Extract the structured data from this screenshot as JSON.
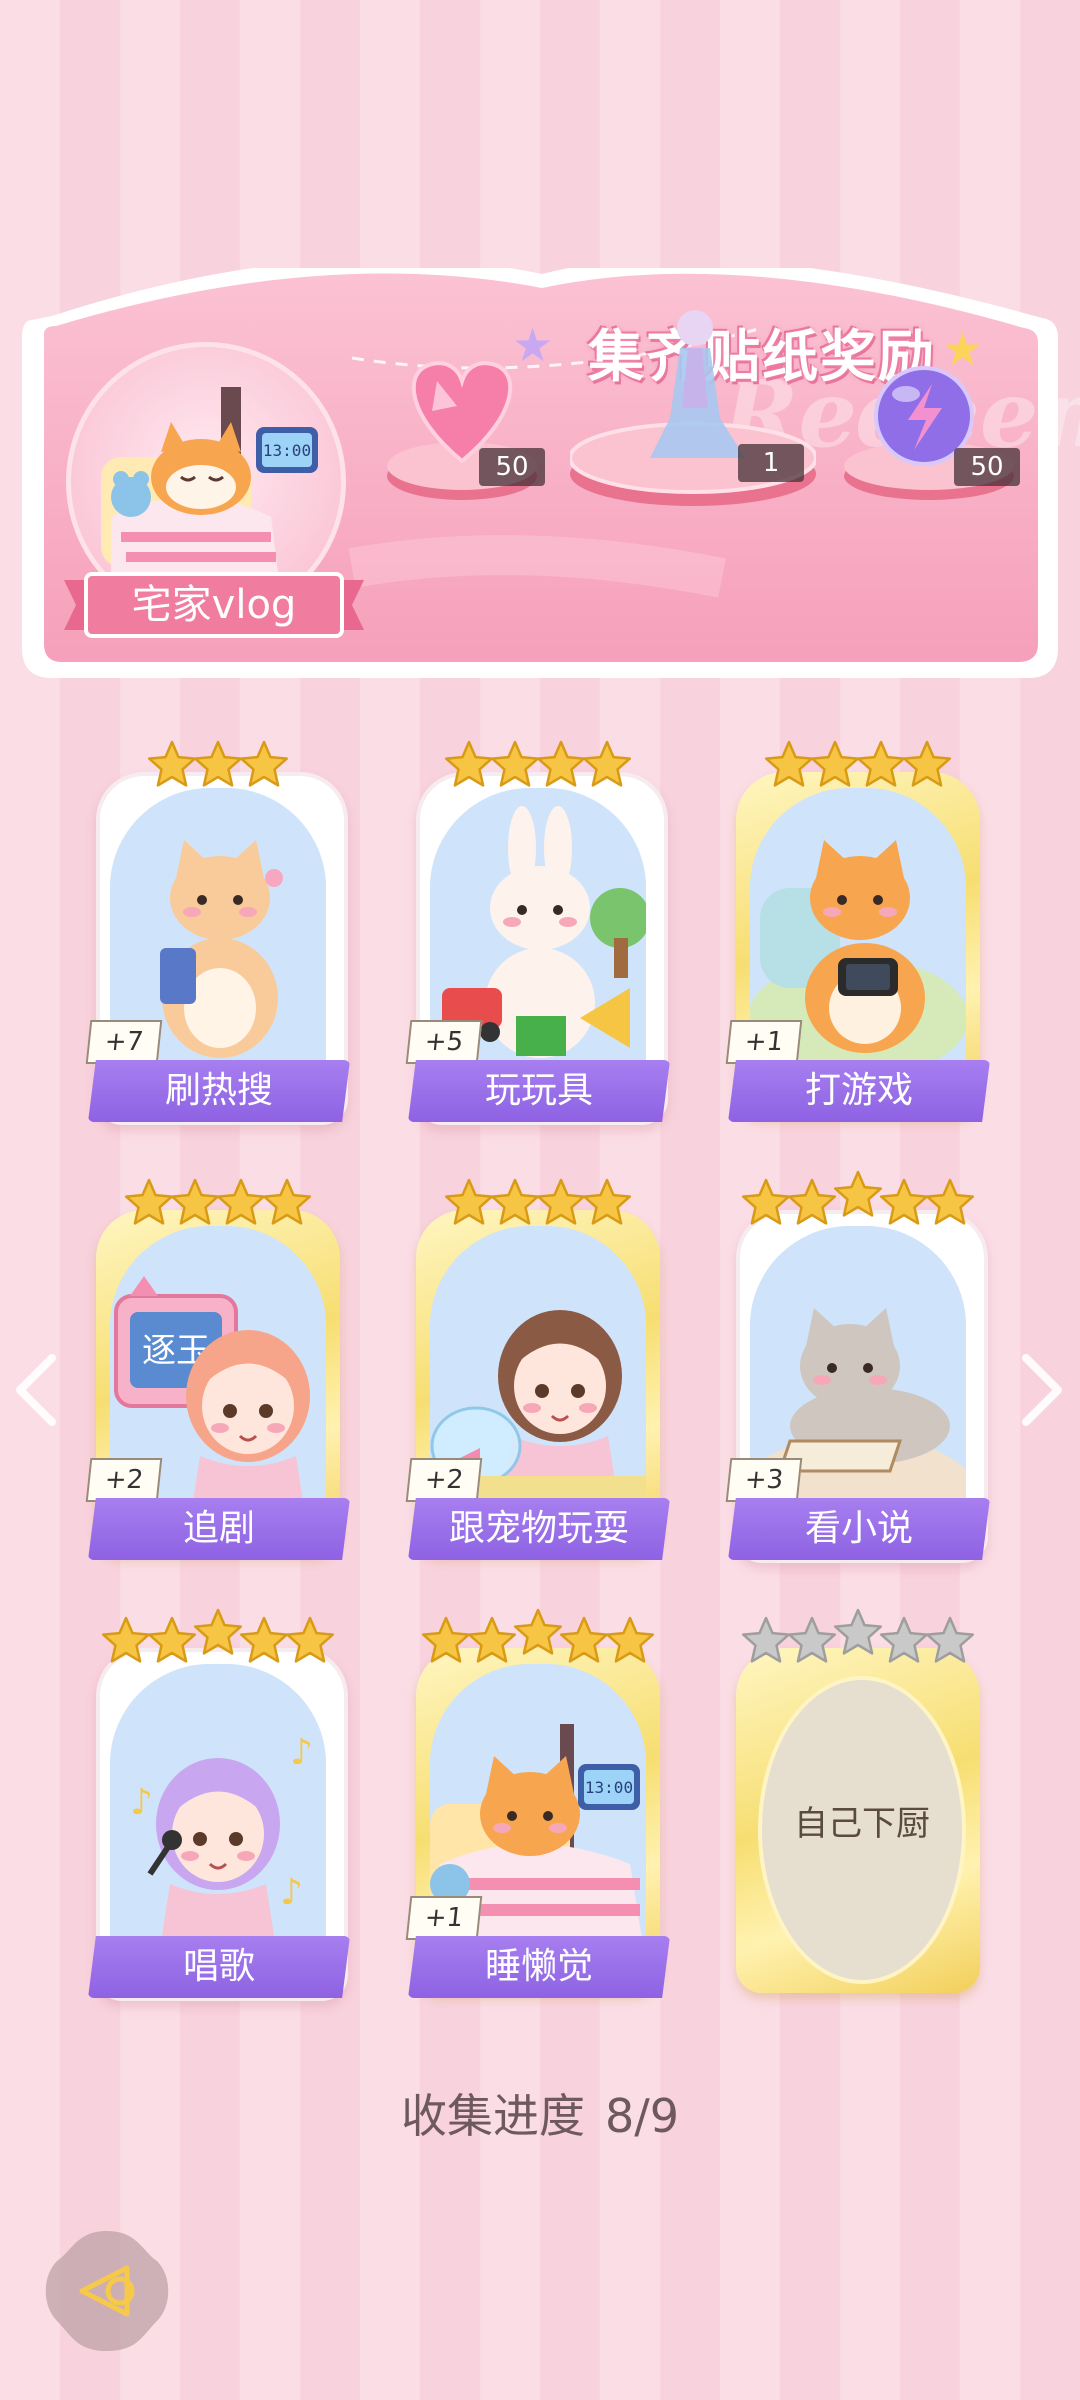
{
  "banner": {
    "title": "集齐贴纸奖励",
    "watermark": "Redeem",
    "set_name": "宅家vlog",
    "rewards": [
      {
        "icon": "heart-gem-icon",
        "count": "50"
      },
      {
        "icon": "outfit-figure-icon",
        "count": "1"
      },
      {
        "icon": "energy-orb-icon",
        "count": "50"
      }
    ]
  },
  "cards": [
    {
      "label": "刷热搜",
      "plus": "+7",
      "stars": 3,
      "frame": "white",
      "art": "cat-with-phone"
    },
    {
      "label": "玩玩具",
      "plus": "+5",
      "stars": 4,
      "frame": "white",
      "art": "bunny-with-toys"
    },
    {
      "label": "打游戏",
      "plus": "+1",
      "stars": 4,
      "frame": "gold",
      "art": "cat-with-console"
    },
    {
      "label": "追剧",
      "plus": "+2",
      "stars": 4,
      "frame": "gold",
      "art": "girl-with-tv",
      "tv_text": "逐玉"
    },
    {
      "label": "跟宠物玩耍",
      "plus": "+2",
      "stars": 4,
      "frame": "gold",
      "art": "girl-with-fishbowl"
    },
    {
      "label": "看小说",
      "plus": "+3",
      "stars": 5,
      "frame": "white",
      "art": "cat-with-book"
    },
    {
      "label": "唱歌",
      "plus": "",
      "stars": 5,
      "frame": "white",
      "art": "girl-singing"
    },
    {
      "label": "睡懒觉",
      "plus": "+1",
      "stars": 5,
      "frame": "gold",
      "art": "cat-sleeping",
      "clock_text": "13:00"
    },
    {
      "label": "自己下厨",
      "plus": "",
      "stars": 5,
      "frame": "gold",
      "locked": true
    }
  ],
  "progress": {
    "label": "收集进度",
    "value": "8/9"
  },
  "banner_clock_text": "13:00",
  "colors": {
    "label_purple": "#9a6ee8",
    "banner_pink": "#f6a3bd",
    "gold_star": "#f6c543",
    "grey_star": "#c9c9c9"
  }
}
